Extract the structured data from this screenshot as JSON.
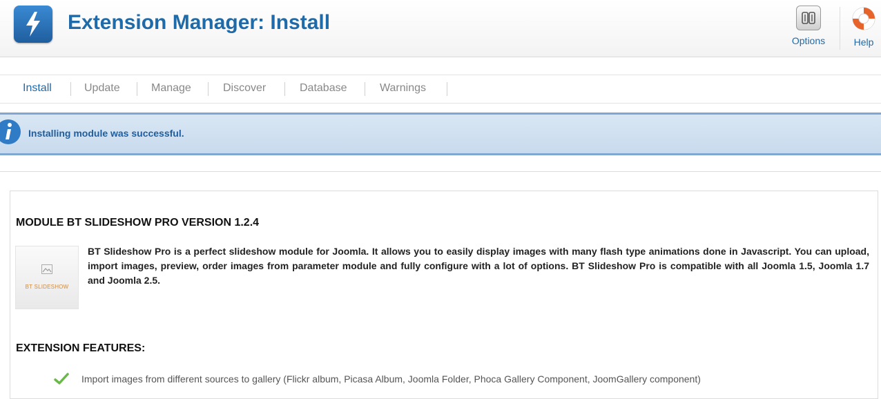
{
  "header": {
    "title": "Extension Manager: Install",
    "toolbar": {
      "options_label": "Options",
      "help_label": "Help"
    }
  },
  "tabs": [
    {
      "label": "Install",
      "active": true
    },
    {
      "label": "Update"
    },
    {
      "label": "Manage"
    },
    {
      "label": "Discover"
    },
    {
      "label": "Database"
    },
    {
      "label": "Warnings"
    }
  ],
  "message": {
    "text": "Installing module was successful."
  },
  "module": {
    "title": "MODULE BT SLIDESHOW PRO VERSION 1.2.4",
    "thumbnail_text": "BT SLIDESHOW",
    "description": "BT Slideshow Pro is a perfect slideshow module for Joomla. It allows you to easily display images with many flash type animations done in Javascript. You can upload, import images, preview, order images from parameter module and fully configure with a lot of options. BT Slideshow Pro is compatible with all Joomla 1.5, Joomla 1.7 and Joomla 2.5."
  },
  "features": {
    "title": "EXTENSION FEATURES:",
    "items": [
      "Import images from different sources to gallery (Flickr album, Picasa Album, Joomla Folder, Phoca Gallery Component, JoomGallery component)"
    ]
  },
  "colors": {
    "brand": "#1f6aa8",
    "message_bg": "#d9e7f4",
    "message_border": "#7fa7d1"
  },
  "icons": {
    "logo": "lightning-bolt-icon",
    "options": "options-icon",
    "help": "lifebuoy-icon",
    "info": "info-icon",
    "check": "checkmark-icon"
  }
}
